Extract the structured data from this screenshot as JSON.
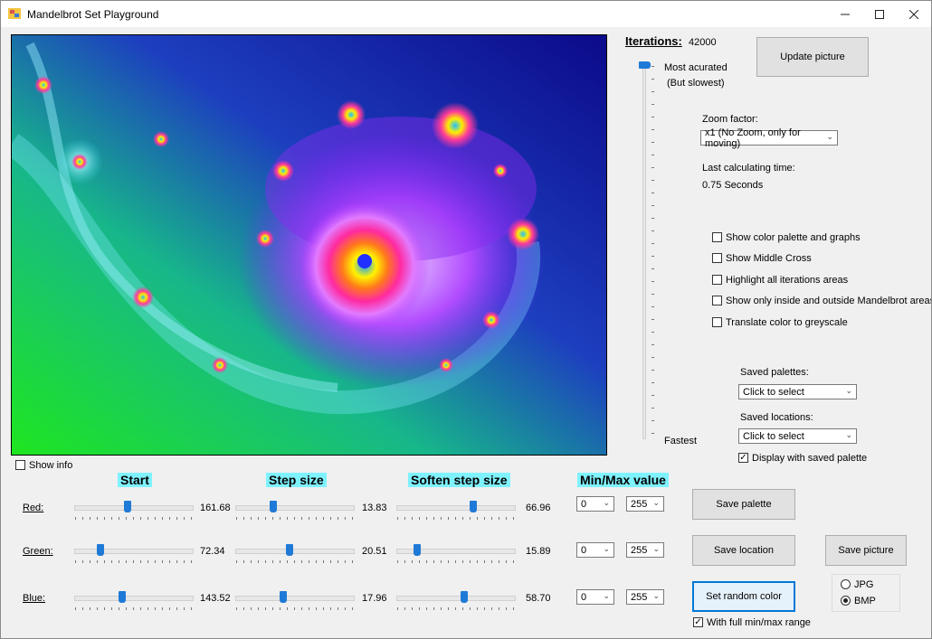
{
  "window": {
    "title": "Mandelbrot Set Playground"
  },
  "controls_top": {
    "iterations_label": "Iterations:",
    "iterations_value": "42000",
    "update_button": "Update picture",
    "slider_top_label": "Most acurated",
    "slider_top_sub": "(But slowest)",
    "slider_bottom_label": "Fastest",
    "zoom_label": "Zoom factor:",
    "zoom_value": "x1 (No Zoom, only for moving)",
    "calc_label": "Last calculating time:",
    "calc_value": "0.75 Seconds"
  },
  "options": [
    {
      "label": "Show color palette and graphs",
      "checked": false
    },
    {
      "label": "Show Middle Cross",
      "checked": false
    },
    {
      "label": "Highlight all iterations areas",
      "checked": false
    },
    {
      "label": "Show only inside and outside Mandelbrot areas",
      "checked": false
    },
    {
      "label": "Translate color to greyscale",
      "checked": false
    }
  ],
  "saved": {
    "palettes_label": "Saved palettes:",
    "palettes_value": "Click to select",
    "locations_label": "Saved locations:",
    "locations_value": "Click to select",
    "display_palette_label": "Display with saved palette",
    "display_palette_checked": true
  },
  "show_info": {
    "label": "Show info",
    "checked": false
  },
  "headers": {
    "start": "Start",
    "step": "Step size",
    "soften": "Soften step size",
    "minmax": "Min/Max value"
  },
  "rows": [
    {
      "label": "Red:",
      "start": "161.68",
      "step": "13.83",
      "soften": "66.96",
      "min": "0",
      "max": "255"
    },
    {
      "label": "Green:",
      "start": "72.34",
      "step": "20.51",
      "soften": "15.89",
      "min": "0",
      "max": "255"
    },
    {
      "label": "Blue:",
      "start": "143.52",
      "step": "17.96",
      "soften": "58.70",
      "min": "0",
      "max": "255"
    }
  ],
  "buttons": {
    "save_palette": "Save  palette",
    "save_location": "Save location",
    "save_picture": "Save picture",
    "random_color": "Set random color"
  },
  "full_range": {
    "label": "With full min/max range",
    "checked": true
  },
  "format": {
    "jpg": "JPG",
    "bmp": "BMP",
    "selected": "BMP"
  }
}
